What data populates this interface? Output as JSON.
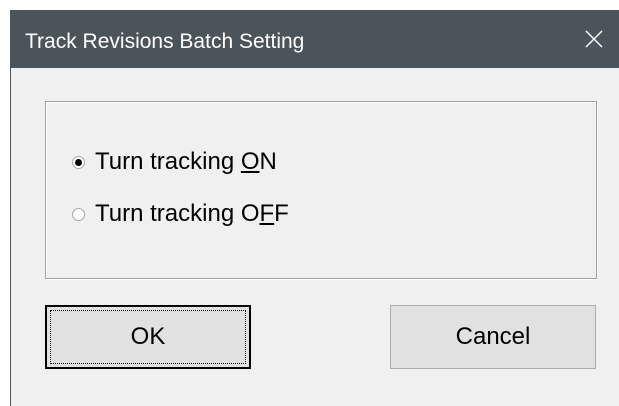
{
  "dialog": {
    "title": "Track Revisions Batch Setting",
    "close_icon": "close-icon"
  },
  "options": [
    {
      "label_pre": "Turn tracking ",
      "access_key": "O",
      "label_post": "N",
      "selected": true
    },
    {
      "label_pre": "Turn tracking O",
      "access_key": "F",
      "label_post": "F",
      "selected": false
    }
  ],
  "buttons": {
    "ok_label": "OK",
    "cancel_label": "Cancel"
  },
  "colors": {
    "titlebar": "#4b535b",
    "dialog_bg": "#f0f0f0",
    "button_bg": "#e1e1e1"
  }
}
